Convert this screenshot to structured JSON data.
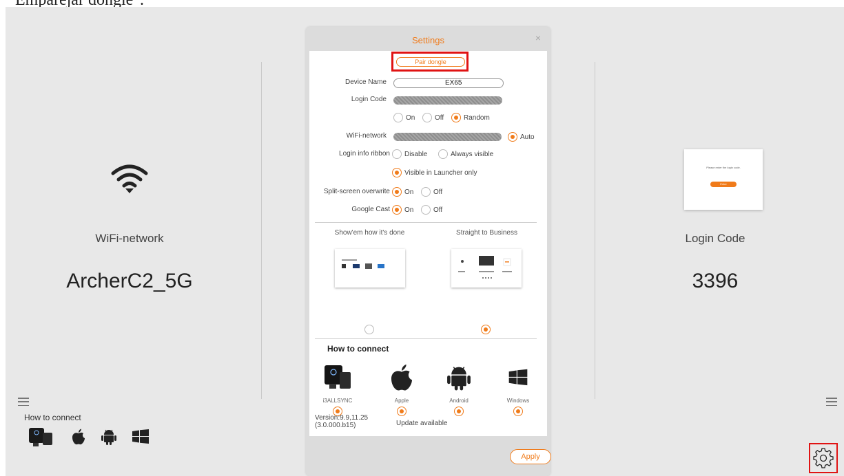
{
  "caption": "Emparejar dongle\".",
  "left": {
    "label": "WiFi-network",
    "value": "ArcherC2_5G",
    "icon": "wifi-icon"
  },
  "right": {
    "label": "Login Code",
    "value": "3396",
    "preview_text": "Please enter the login code.",
    "preview_button": "Enter"
  },
  "bottom": {
    "how_to_connect": "How to connect"
  },
  "dialog": {
    "title": "Settings",
    "close": "×",
    "pair_dongle": "Pair dongle",
    "device_name_label": "Device Name",
    "device_name_value": "EX65",
    "login_code_label": "Login Code",
    "login_code_options": [
      "On",
      "Off",
      "Random"
    ],
    "login_code_selected": "Random",
    "wifi_label": "WiFi-network",
    "wifi_option": "Auto",
    "ribbon_label": "Login info ribbon",
    "ribbon_options": [
      "Disable",
      "Always visible",
      "Visible in Launcher only"
    ],
    "ribbon_selected": "Visible in Launcher only",
    "split_label": "Split-screen overwrite",
    "split_options": [
      "On",
      "Off"
    ],
    "split_selected": "On",
    "cast_label": "Google Cast",
    "cast_options": [
      "On",
      "Off"
    ],
    "cast_selected": "On",
    "template_1": "Show'em how it's done",
    "template_2": "Straight to Business",
    "template_selected": "Straight to Business",
    "how_to_connect": "How to connect",
    "platforms": [
      "i3ALLSYNC",
      "Apple",
      "Android",
      "Windows"
    ],
    "version_line1": "Version:9.9,11.25",
    "version_line2": "(3.0.000.b15)",
    "update": "Update available",
    "apply": "Apply"
  },
  "colors": {
    "accent": "#f07b1a",
    "highlight": "#e01313",
    "background": "#e8e8e8"
  }
}
